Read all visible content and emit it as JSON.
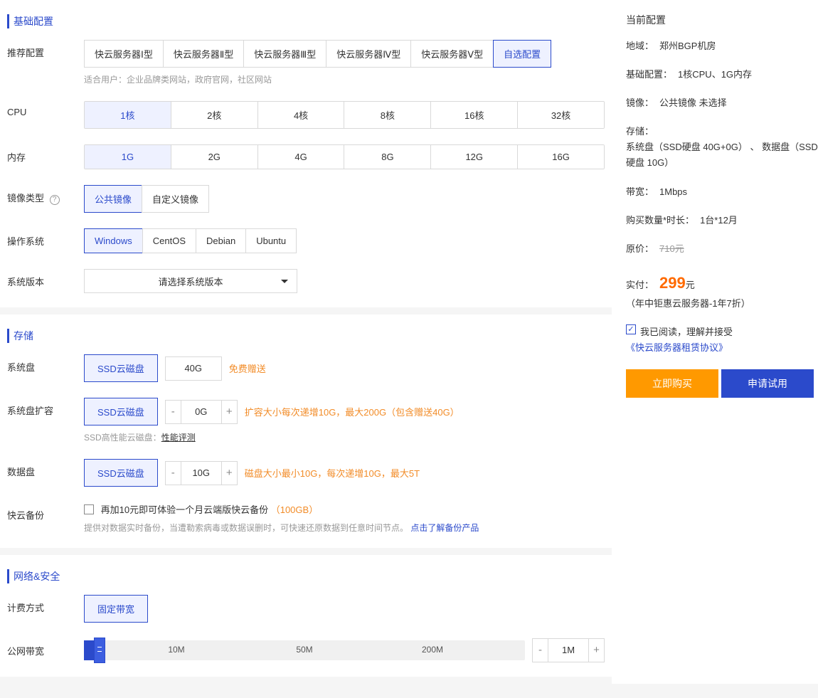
{
  "sections": {
    "basic": "基础配置",
    "storage": "存储",
    "network": "网络&安全"
  },
  "labels": {
    "recommend": "推荐配置",
    "cpu": "CPU",
    "memory": "内存",
    "imageType": "镜像类型",
    "os": "操作系统",
    "sysVersion": "系统版本",
    "sysDisk": "系统盘",
    "sysDiskExt": "系统盘扩容",
    "dataDisk": "数据盘",
    "backup": "快云备份",
    "billing": "计费方式",
    "bandwidth": "公网带宽"
  },
  "recommend": {
    "options": [
      "快云服务器Ⅰ型",
      "快云服务器Ⅱ型",
      "快云服务器Ⅲ型",
      "快云服务器Ⅳ型",
      "快云服务器Ⅴ型",
      "自选配置"
    ],
    "selected": 5,
    "hint": "适合用户：企业品牌类网站，政府官网，社区网站"
  },
  "cpu": {
    "options": [
      "1核",
      "2核",
      "4核",
      "8核",
      "16核",
      "32核"
    ],
    "selected": 0
  },
  "memory": {
    "options": [
      "1G",
      "2G",
      "4G",
      "8G",
      "12G",
      "16G"
    ],
    "selected": 0
  },
  "imageType": {
    "options": [
      "公共镜像",
      "自定义镜像"
    ],
    "selected": 0,
    "help": "?"
  },
  "os": {
    "options": [
      "Windows",
      "CentOS",
      "Debian",
      "Ubuntu"
    ],
    "selected": 0
  },
  "sysVersion": {
    "placeholder": "请选择系统版本"
  },
  "sysDisk": {
    "type": "SSD云磁盘",
    "size": "40G",
    "gift": "免费赠送"
  },
  "sysDiskExt": {
    "type": "SSD云磁盘",
    "value": "0G",
    "hint": "扩容大小每次递增10G，最大200G（包含赠送40G）",
    "perfPrefix": "SSD高性能云磁盘：",
    "perfLink": "性能评测"
  },
  "dataDisk": {
    "type": "SSD云磁盘",
    "value": "10G",
    "hint": "磁盘大小最小10G，每次递增10G，最大5T"
  },
  "backup": {
    "checkText": "再加10元即可体验一个月云端版快云备份",
    "checkSuffix": "（100GB）",
    "desc": "提供对数据实时备份，当遭勒索病毒或数据误删时，可快速还原数据到任意时间节点。",
    "link": "点击了解备份产品"
  },
  "billing": {
    "option": "固定带宽"
  },
  "bandwidth": {
    "marks": [
      "10M",
      "50M",
      "200M"
    ],
    "value": "1M"
  },
  "aside": {
    "title": "当前配置",
    "region": {
      "label": "地域：",
      "value": "郑州BGP机房"
    },
    "basic": {
      "label": "基础配置：",
      "value": "1核CPU、1G内存"
    },
    "image": {
      "label": "镜像：",
      "value": "公共镜像 未选择"
    },
    "storage": {
      "label": "存储：",
      "value": "系统盘（SSD硬盘 40G+0G） 、 数据盘（SSD硬盘 10G）"
    },
    "bw": {
      "label": "带宽：",
      "value": "1Mbps"
    },
    "qty": {
      "label": "购买数量*时长：",
      "value": "1台*12月"
    },
    "orig": {
      "label": "原价：",
      "value": "710元"
    },
    "pay": {
      "label": "实付：",
      "price": "299",
      "unit": "元",
      "note": "（年中钜惠云服务器-1年7折）"
    },
    "agree": {
      "text": "我已阅读，理解并接受",
      "link": "《快云服务器租赁协议》"
    },
    "buy": "立即购买",
    "try": "申请试用"
  }
}
